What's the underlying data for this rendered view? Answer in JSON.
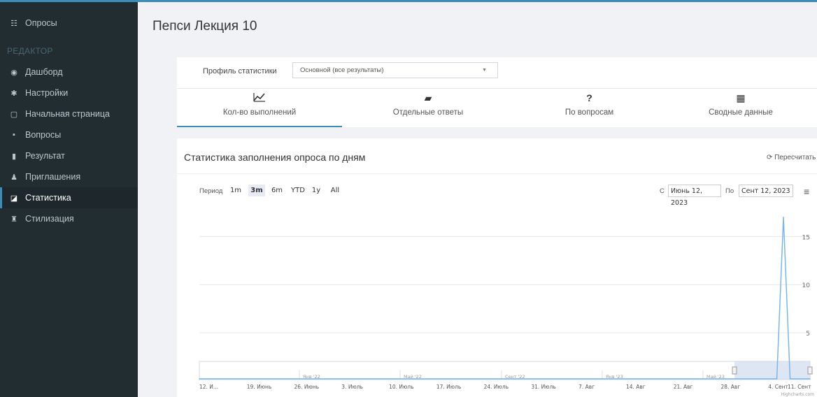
{
  "sidebar": {
    "section_header": "РЕДАКТОР",
    "items": [
      {
        "label": "Опросы",
        "icon": "survey-list-icon",
        "glyph": "☷"
      },
      {
        "label": "Дашборд",
        "icon": "dashboard-icon",
        "glyph": "◉"
      },
      {
        "label": "Настройки",
        "icon": "gear-icon",
        "glyph": "✱"
      },
      {
        "label": "Начальная страница",
        "icon": "document-icon",
        "glyph": "▢"
      },
      {
        "label": "Вопросы",
        "icon": "questions-icon",
        "glyph": "▪"
      },
      {
        "label": "Результат",
        "icon": "bar-chart-icon",
        "glyph": "▮"
      },
      {
        "label": "Приглашения",
        "icon": "user-add-icon",
        "glyph": "♟"
      },
      {
        "label": "Статистика",
        "icon": "line-chart-icon",
        "glyph": "◪"
      },
      {
        "label": "Стилизация",
        "icon": "paint-icon",
        "glyph": "♜"
      }
    ]
  },
  "page": {
    "title": "Пепси Лекция 10"
  },
  "profile": {
    "label": "Профиль статистики",
    "value": "Основной (все результаты)"
  },
  "tabs": [
    {
      "label": "Кол-во выполнений",
      "icon": "line-chart-icon",
      "glyph": "⟋"
    },
    {
      "label": "Отдельные ответы",
      "icon": "book-icon",
      "glyph": "▰"
    },
    {
      "label": "По вопросам",
      "icon": "question-icon",
      "glyph": "?"
    },
    {
      "label": "Сводные данные",
      "icon": "table-icon",
      "glyph": "▦"
    }
  ],
  "stats": {
    "title": "Статистика заполнения опроса по дням",
    "recount_label": "Пересчитать"
  },
  "range": {
    "period_label": "Период",
    "buttons": [
      "1m",
      "3m",
      "6m",
      "YTD",
      "1y",
      "All"
    ],
    "selected": "3m",
    "from_label": "С",
    "from_value": "Июнь 12, 2023",
    "to_label": "По",
    "to_value": "Сент 12, 2023"
  },
  "colors": {
    "accent": "#3c8dbc",
    "sidebar": "#222d32",
    "series": "#7cb5ec"
  },
  "chart_data": {
    "type": "line",
    "title": "",
    "xlabel": "",
    "ylabel": "",
    "y_ticks": [
      5,
      10,
      15
    ],
    "ylim": [
      0,
      18
    ],
    "x_ticks": [
      "12. И...",
      "19. Июнь",
      "26. Июнь",
      "3. Июль",
      "10. Июль",
      "17. Июль",
      "24. Июль",
      "31. Июль",
      "7. Авг",
      "14. Авг",
      "21. Авг",
      "28. Авг",
      "4. Сент",
      "11. Сент"
    ],
    "series": [
      {
        "x": [
          "2023-06-12",
          "2023-09-07",
          "2023-09-08",
          "2023-09-09",
          "2023-09-12"
        ],
        "values": [
          0,
          0,
          17,
          0,
          0
        ]
      }
    ],
    "navigator_labels": [
      "Янв '22",
      "Май '22",
      "Сент '22",
      "Янв '23",
      "Май '23"
    ],
    "credits": "Highcharts.com"
  }
}
